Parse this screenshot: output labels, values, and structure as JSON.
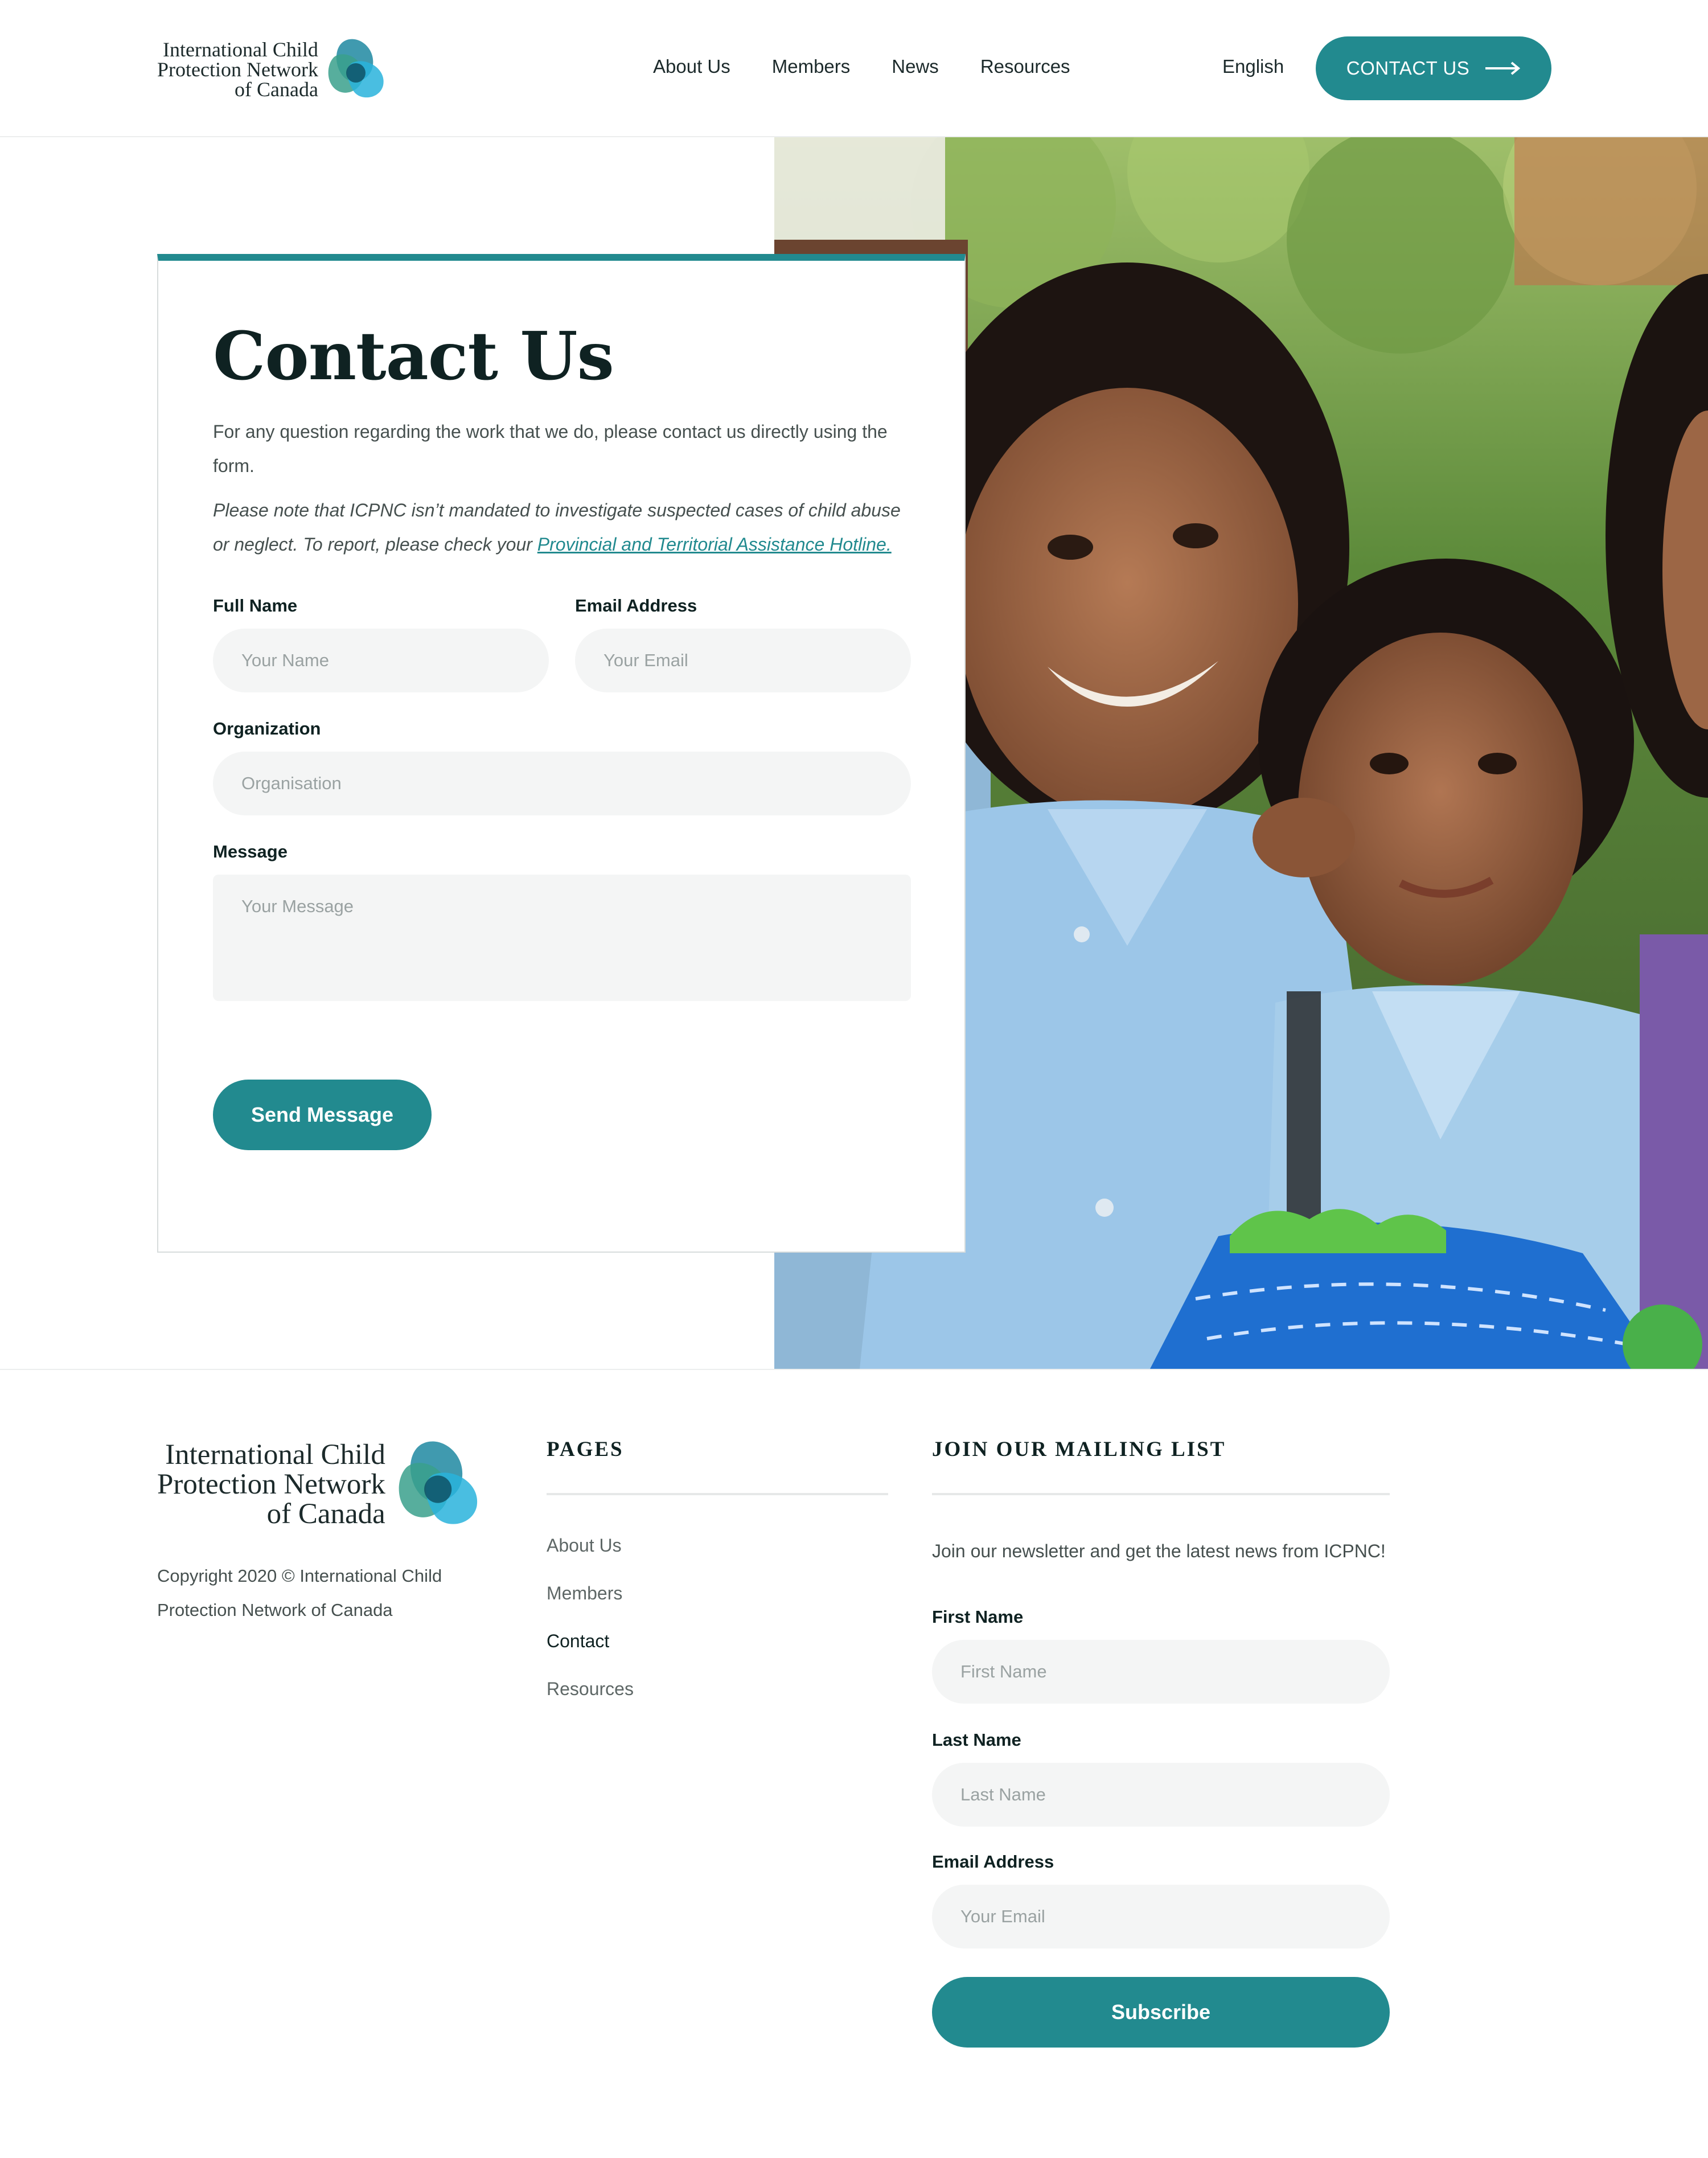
{
  "logo": {
    "lines": [
      "International Child",
      "Protection Network",
      "of Canada"
    ]
  },
  "header": {
    "nav": [
      {
        "label": "About Us"
      },
      {
        "label": "Members"
      },
      {
        "label": "News"
      },
      {
        "label": "Resources"
      }
    ],
    "language": "English",
    "cta_label": "CONTACT US",
    "cta_icon": "arrow-right-icon"
  },
  "contact": {
    "title": "Contact Us",
    "intro": "For any question regarding the work that we do, please contact us directly using the form.",
    "note_text": "Please note that ICPNC isn’t mandated to investigate suspected cases of child abuse or neglect. To report, please check your ",
    "note_link": "Provincial and Territorial Assistance Hotline.",
    "form": {
      "full_name_label": "Full Name",
      "full_name_placeholder": "Your Name",
      "email_label": "Email Address",
      "email_placeholder": "Your Email",
      "organization_label": "Organization",
      "organization_placeholder": "Organisation",
      "message_label": "Message",
      "message_placeholder": "Your Message",
      "submit_label": "Send Message"
    }
  },
  "footer": {
    "copyright": "Copyright 2020 © International Child Protection Network of Canada",
    "pages_heading": "PAGES",
    "pages": [
      {
        "label": "About Us",
        "active": false
      },
      {
        "label": "Members",
        "active": false
      },
      {
        "label": "Contact",
        "active": true
      },
      {
        "label": "Resources",
        "active": false
      }
    ],
    "mailing_heading": "JOIN OUR MAILING LIST",
    "mailing_intro": "Join our newsletter and get the latest news from ICPNC!",
    "first_name_label": "First Name",
    "first_name_placeholder": "First Name",
    "last_name_label": "Last Name",
    "last_name_placeholder": "Last Name",
    "email_label": "Email Address",
    "email_placeholder": "Your Email",
    "subscribe_label": "Subscribe"
  },
  "colors": {
    "accent": "#228a8f",
    "heading": "#0f2222",
    "body_text": "#46504f",
    "field_bg": "#f4f5f5"
  }
}
